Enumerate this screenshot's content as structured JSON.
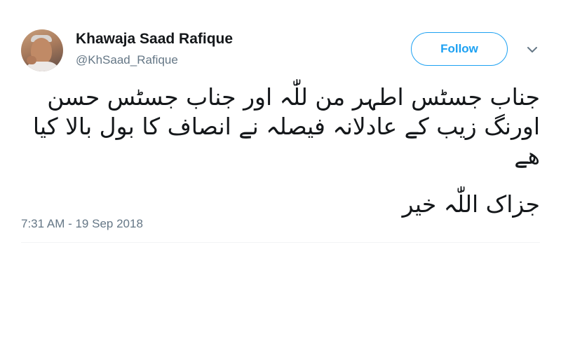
{
  "tweet": {
    "author": {
      "display_name": "Khawaja Saad Rafique",
      "handle": "@KhSaad_Rafique"
    },
    "follow_label": "Follow",
    "more_icon": "chevron-down-icon",
    "text_paragraph_1": "جناب جسٹس اطہر من للّٰہ اور جناب جسٹس حسن اورنگ زیب کے عادلانہ فیصلہ نے انصاف کا بول بالا کیا ھے",
    "text_paragraph_2": "جزاک اللّٰہ خیر",
    "timestamp": "7:31 AM - 19 Sep 2018"
  },
  "colors": {
    "accent": "#1da1f2",
    "text_primary": "#14171a",
    "text_secondary": "#657786"
  }
}
